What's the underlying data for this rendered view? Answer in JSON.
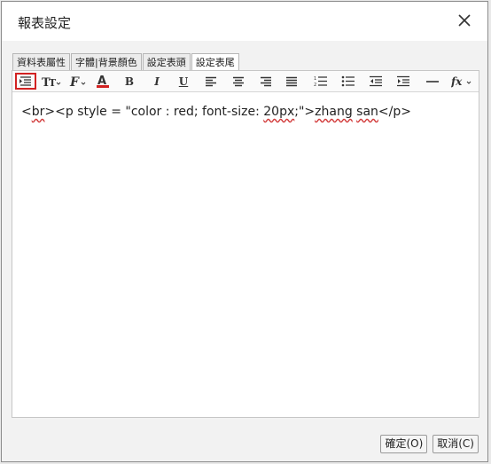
{
  "dialog": {
    "title": "報表設定"
  },
  "tabs": [
    {
      "label": "資料表屬性",
      "active": false
    },
    {
      "label": "字體|背景顏色",
      "active": false
    },
    {
      "label": "設定表頭",
      "active": false
    },
    {
      "label": "設定表尾",
      "active": true
    }
  ],
  "toolbar": {
    "buttons": [
      {
        "name": "insert-line-break-icon",
        "selected": true
      },
      {
        "name": "font-size-icon"
      },
      {
        "name": "font-family-icon"
      },
      {
        "name": "font-color-icon"
      },
      {
        "name": "bold-icon",
        "glyph": "B"
      },
      {
        "name": "italic-icon",
        "glyph": "I"
      },
      {
        "name": "underline-icon",
        "glyph": "U"
      },
      {
        "name": "align-left-icon"
      },
      {
        "name": "align-center-icon"
      },
      {
        "name": "align-right-icon"
      },
      {
        "name": "align-justify-icon"
      },
      {
        "name": "ordered-list-icon"
      },
      {
        "name": "unordered-list-icon"
      },
      {
        "name": "outdent-icon"
      },
      {
        "name": "indent-icon"
      },
      {
        "name": "horizontal-rule-icon"
      },
      {
        "name": "function-icon",
        "glyph": "fx"
      }
    ],
    "font_color": "#1e57c8"
  },
  "editor": {
    "content": {
      "p1": "<",
      "w1": "br",
      "p2": "><p style = \"color : red; font-size: ",
      "w2": "20px",
      "p3": ";\">",
      "w3": "zhang",
      "p4": " ",
      "w4": "san",
      "p5": "</p>"
    }
  },
  "buttons": {
    "ok": "確定(O)",
    "cancel": "取消(C)"
  }
}
